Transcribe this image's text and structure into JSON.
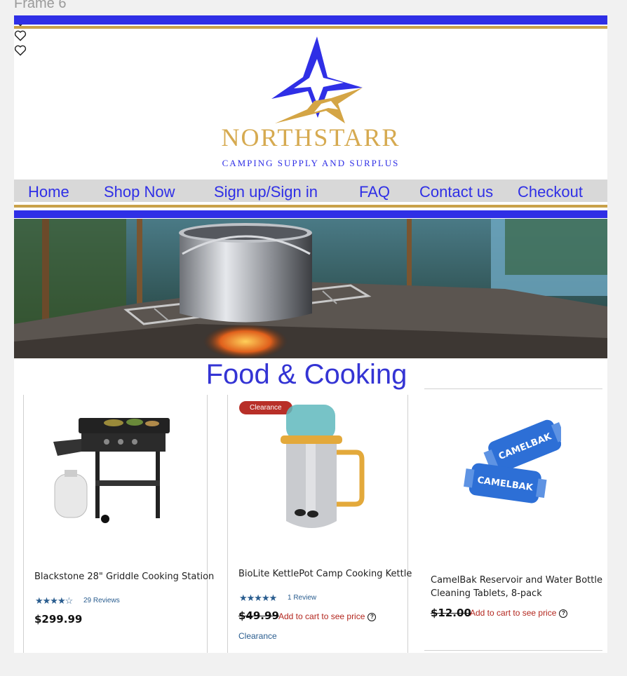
{
  "frame_label": "Frame 6",
  "brand": {
    "name": "NORTHSTARR",
    "tagline": "CAMPING SUPPLY AND SURPLUS",
    "colors": {
      "blue": "#2f2fe6",
      "gold": "#c9a24a"
    }
  },
  "nav": {
    "items": [
      "Home",
      "Shop Now",
      "Sign up/Sign in",
      "FAQ",
      "Contact us",
      "Checkout"
    ]
  },
  "hero": {
    "image": "camp-stove-pot-photo"
  },
  "section": {
    "title": "Food & Cooking"
  },
  "products": [
    {
      "name": "Blackstone 28\" Griddle Cooking Station",
      "rating": "★★★★☆",
      "reviews": "29 Reviews",
      "price": "$299.99",
      "image": "griddle-image"
    },
    {
      "badge": "Clearance",
      "name": "BioLite KettlePot Camp Cooking Kettle",
      "rating": "★★★★★",
      "reviews": "1 Review",
      "price": "$49.99",
      "cart_note": "Add to cart to see price",
      "link": "Clearance",
      "image": "kettle-image"
    },
    {
      "name_line1": "CamelBak Reservoir and Water Bottle",
      "name_line2": "Cleaning Tablets, 8-pack",
      "price": "$12.00",
      "cart_note": "Add to cart to see price",
      "image": "cleaning-tablets-image"
    }
  ]
}
